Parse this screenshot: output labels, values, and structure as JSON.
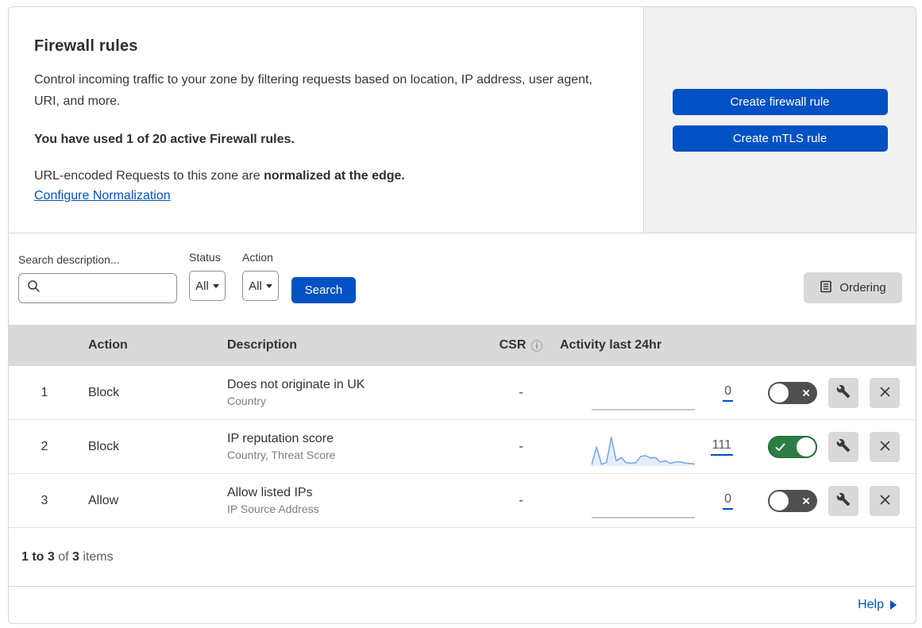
{
  "colors": {
    "accent_blue": "#0051c3",
    "toggle_on_green": "#2b7d44",
    "toggle_off_gray": "#4f4f4f",
    "sparkline_blue": "#74a3e8",
    "table_header_gray": "#d9d9d9",
    "side_panel_gray": "#f1f1f1"
  },
  "icons": {
    "search": "magnifier",
    "ordering": "list-document",
    "csr_info": "circled-i",
    "edit": "wrench",
    "delete": "x-cross",
    "toggle_off_glyph": "×",
    "toggle_on_glyph": "checkmark",
    "help_arrow": "right-triangle"
  },
  "header": {
    "title": "Firewall rules",
    "description": "Control incoming traffic to your zone by filtering requests based on location, IP address, user agent, URI, and more.",
    "usage": "You have used 1 of 20 active Firewall rules.",
    "normalization_text": "URL-encoded Requests to this zone are",
    "normalization_bold": "normalized at the edge.",
    "normalization_link": "Configure Normalization",
    "create_firewall_button": "Create firewall rule",
    "create_mtls_button": "Create mTLS rule"
  },
  "filters": {
    "search_label": "Search description...",
    "status_label": "Status",
    "status_value": "All",
    "action_label": "Action",
    "action_value": "All",
    "search_button": "Search",
    "ordering_button": "Ordering"
  },
  "table": {
    "headers": {
      "action": "Action",
      "description": "Description",
      "csr": "CSR",
      "activity": "Activity last 24hr"
    },
    "rows": [
      {
        "priority": "1",
        "action": "Block",
        "description": "Does not originate in UK",
        "fields": "Country",
        "csr": "-",
        "activity_count": "0",
        "enabled": false,
        "sparkline": []
      },
      {
        "priority": "2",
        "action": "Block",
        "description": "IP reputation score",
        "fields": "Country, Threat Score",
        "csr": "-",
        "activity_count": "111",
        "enabled": true,
        "sparkline": [
          4,
          66,
          6,
          12,
          100,
          18,
          30,
          12,
          10,
          12,
          34,
          36,
          28,
          30,
          14,
          18,
          10,
          14,
          15,
          10,
          9,
          7
        ]
      },
      {
        "priority": "3",
        "action": "Allow",
        "description": "Allow listed IPs",
        "fields": "IP Source Address",
        "csr": "-",
        "activity_count": "0",
        "enabled": false,
        "sparkline": []
      }
    ]
  },
  "footer": {
    "range": "1 to 3",
    "of": "of",
    "total": "3",
    "items": "items"
  },
  "help": {
    "label": "Help"
  }
}
